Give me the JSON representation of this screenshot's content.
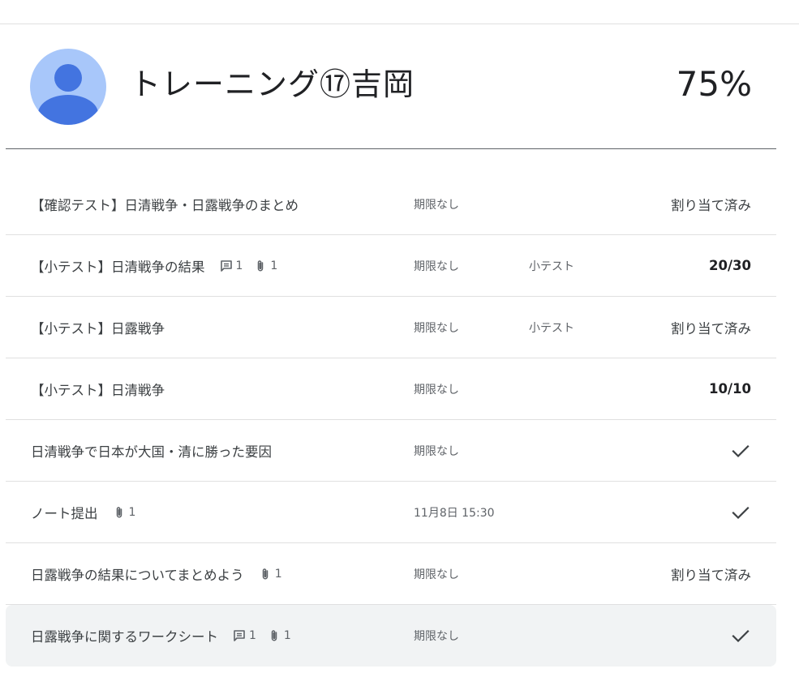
{
  "student": {
    "name": "トレーニング⑰吉岡",
    "overall_grade": "75%",
    "avatar": "person-icon"
  },
  "assignments": [
    {
      "title": "【確認テスト】日清戦争・日露戦争のまとめ",
      "due": "期限なし",
      "topic": "",
      "status": "割り当て済み",
      "status_type": "text"
    },
    {
      "title": "【小テスト】日清戦争の結果",
      "comments": "1",
      "attachments": "1",
      "due": "期限なし",
      "topic": "小テスト",
      "status": "20/30",
      "status_type": "score"
    },
    {
      "title": "【小テスト】日露戦争",
      "due": "期限なし",
      "topic": "小テスト",
      "status": "割り当て済み",
      "status_type": "text"
    },
    {
      "title": "【小テスト】日清戦争",
      "due": "期限なし",
      "topic": "",
      "status": "10/10",
      "status_type": "score"
    },
    {
      "title": "日清戦争で日本が大国・清に勝った要因",
      "due": "期限なし",
      "topic": "",
      "status": "",
      "status_type": "check"
    },
    {
      "title": "ノート提出",
      "attachments": "1",
      "due": "11月8日 15:30",
      "topic": "",
      "status": "",
      "status_type": "check"
    },
    {
      "title": "日露戦争の結果についてまとめよう",
      "attachments": "1",
      "due": "期限なし",
      "topic": "",
      "status": "割り当て済み",
      "status_type": "text"
    },
    {
      "title": "日露戦争に関するワークシート",
      "comments": "1",
      "attachments": "1",
      "due": "期限なし",
      "topic": "",
      "status": "",
      "status_type": "check"
    }
  ],
  "colors": {
    "avatar_bg": "#a8c7fa",
    "avatar_fg": "#4374e0",
    "hover_row": "#f1f3f4"
  }
}
